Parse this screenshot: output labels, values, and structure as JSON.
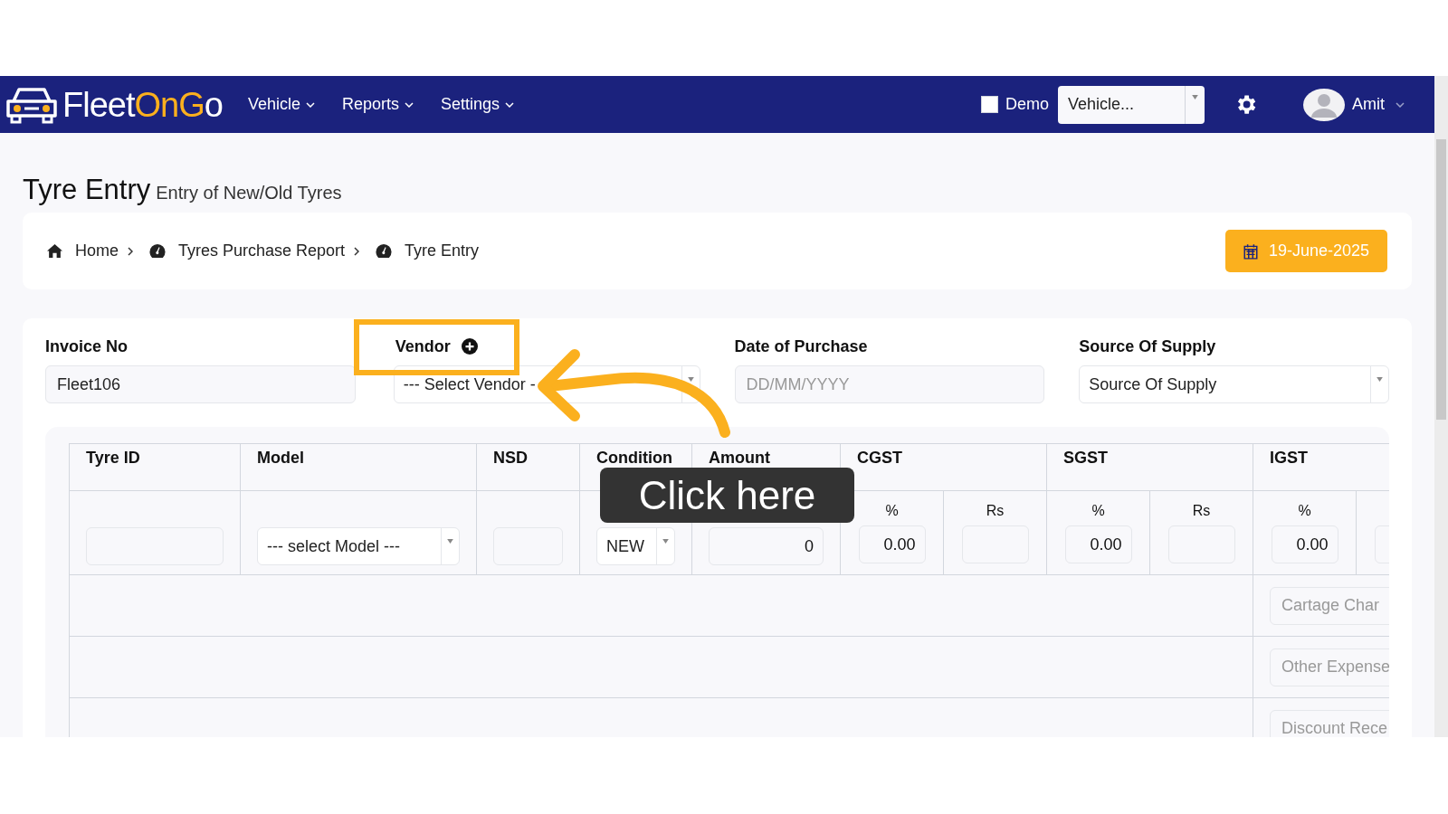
{
  "header": {
    "logo": [
      {
        "text": "Fleet",
        "color": "#ffffff"
      },
      {
        "text": "OnG",
        "color": "#fbb01e"
      },
      {
        "text": "o",
        "color": "#ffffff"
      }
    ],
    "menus": [
      {
        "label": "Vehicle"
      },
      {
        "label": "Reports"
      },
      {
        "label": "Settings"
      }
    ],
    "demo": {
      "label": "Demo",
      "checked": false
    },
    "vehicle_select": {
      "value": "Vehicle..."
    },
    "user": {
      "name": "Amit"
    }
  },
  "page": {
    "title": "Tyre Entry",
    "subtitle": "Entry of New/Old Tyres"
  },
  "breadcrumb": [
    {
      "label": "Home",
      "kind": "home"
    },
    {
      "label": "Tyres Purchase Report",
      "kind": "gauge"
    },
    {
      "label": "Tyre Entry",
      "kind": "gauge"
    }
  ],
  "date_button": "19-June-2025",
  "form": [
    {
      "label": "Invoice No",
      "kind": "text",
      "value": "Fleet106"
    },
    {
      "label": "Vendor",
      "kind": "select",
      "value": "--- Select Vendor -",
      "add_button": true
    },
    {
      "label": "Date of Purchase",
      "kind": "text",
      "placeholder": "DD/MM/YYYY"
    },
    {
      "label": "Source Of Supply",
      "kind": "select",
      "value": "Source Of Supply"
    }
  ],
  "table": {
    "columns": [
      {
        "label": "Tyre ID",
        "kind": "text"
      },
      {
        "label": "Model",
        "kind": "select",
        "value": "--- select Model ---"
      },
      {
        "label": "NSD",
        "kind": "text"
      },
      {
        "label": "Condition",
        "kind": "select",
        "value": "NEW"
      },
      {
        "label": "Amount",
        "kind": "number",
        "value": "0"
      }
    ],
    "tax_columns": [
      {
        "label": "CGST",
        "subcolumns": [
          {
            "label": "%",
            "value": "0.00"
          },
          {
            "label": "Rs"
          }
        ]
      },
      {
        "label": "SGST",
        "subcolumns": [
          {
            "label": "%",
            "value": "0.00"
          },
          {
            "label": "Rs"
          }
        ]
      },
      {
        "label": "IGST",
        "subcolumns": [
          {
            "label": "%",
            "value": "0.00"
          },
          {}
        ]
      }
    ],
    "extra_rows": [
      {
        "placeholder": "Cartage Char"
      },
      {
        "placeholder": "Other Expense"
      },
      {
        "placeholder": "Discount Rece"
      }
    ]
  },
  "annotation": {
    "text": "Click here"
  }
}
